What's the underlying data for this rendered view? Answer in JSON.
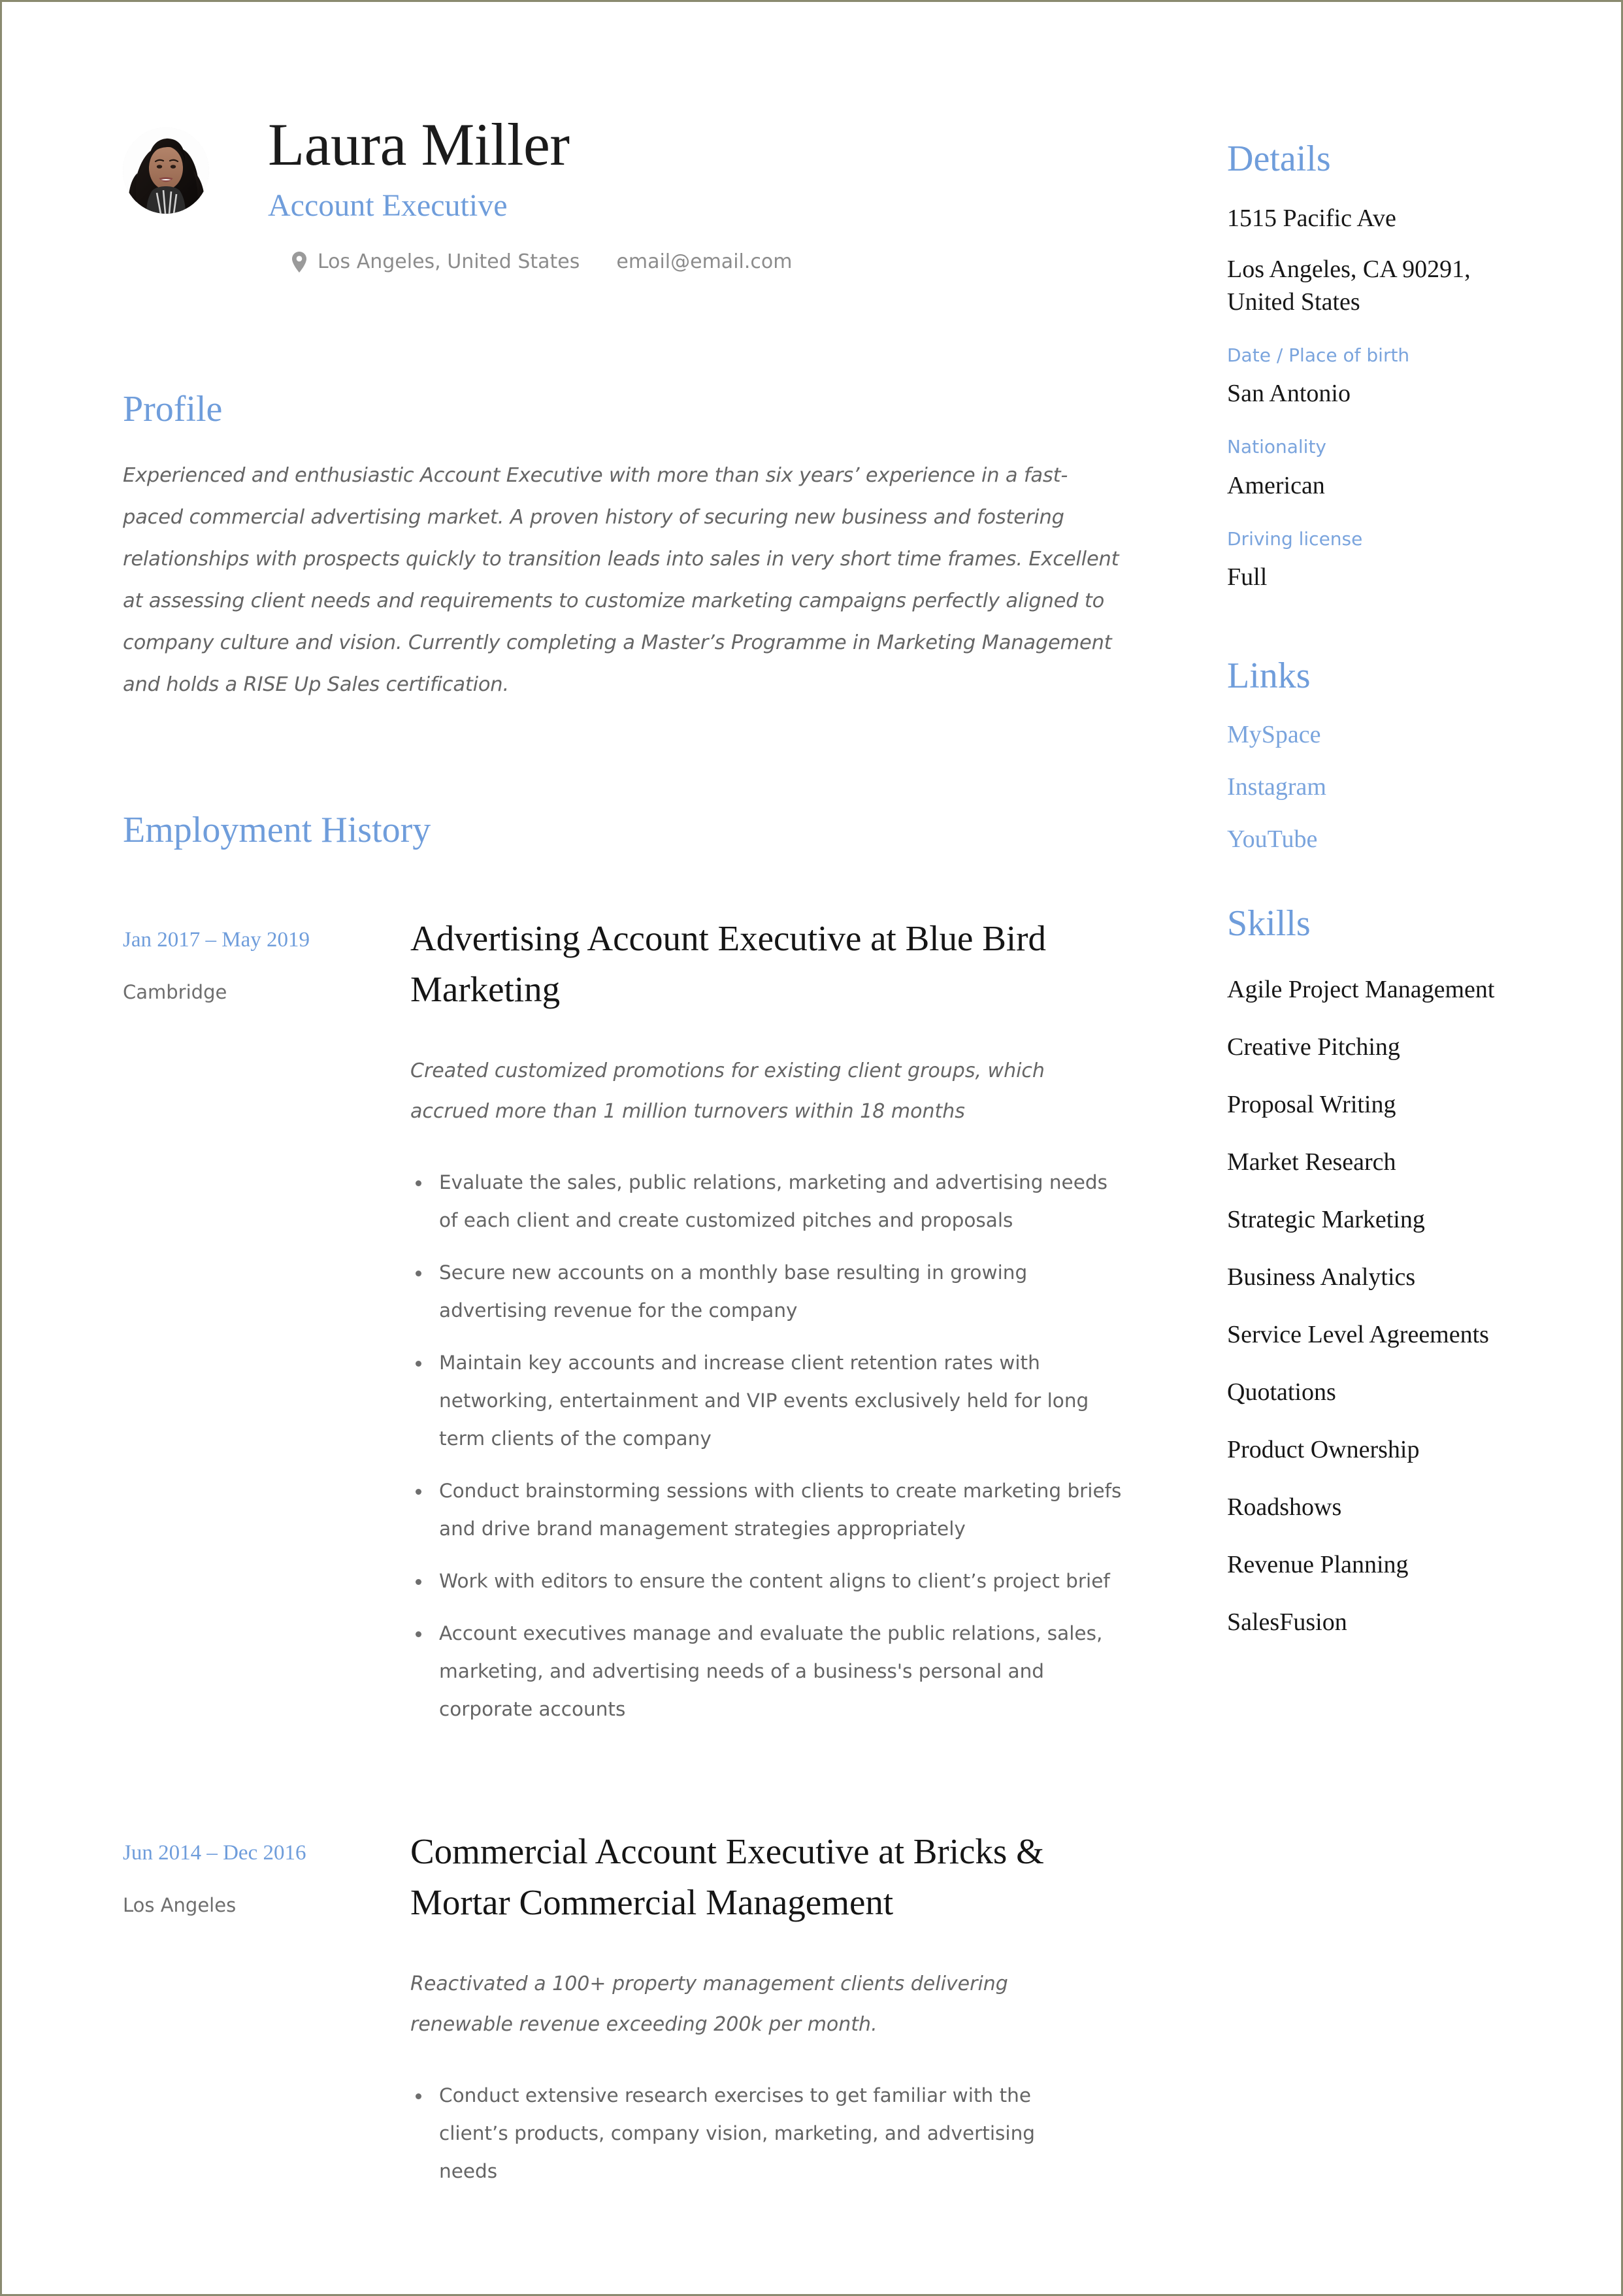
{
  "accent_color": "#6f9ddb",
  "text_color": "#171717",
  "muted_color": "#666666",
  "header": {
    "name": "Laura Miller",
    "job_title": "Account Executive",
    "location": "Los Angeles, United States",
    "email": "email@email.com"
  },
  "profile": {
    "title": "Profile",
    "text": "Experienced and enthusiastic Account Executive with more than six years’ experience in a fast-paced commercial advertising market. A proven history of securing new business and fostering relationships with prospects quickly to transition leads into sales in very short time frames. Excellent at assessing client needs and requirements to customize marketing campaigns perfectly aligned to company culture and vision. Currently completing a Master’s Programme in Marketing Management and holds a RISE Up Sales certification."
  },
  "employment": {
    "title": "Employment History",
    "jobs": [
      {
        "dates": "Jan 2017 – May 2019",
        "location": "Cambridge",
        "heading": "Advertising Account Executive at Blue Bird Marketing",
        "summary": "Created customized promotions for existing client groups, which accrued more than 1 million turnovers within 18 months",
        "bullets": [
          "Evaluate the sales, public relations, marketing and advertising needs of each client and create customized pitches and proposals",
          "Secure new accounts on a monthly base resulting in growing advertising revenue for the company",
          "Maintain key accounts and increase client retention rates with networking, entertainment and VIP events exclusively held for long term clients of the company",
          "Conduct brainstorming sessions with clients to create marketing briefs and drive brand management strategies appropriately",
          "Work with editors to ensure the content aligns to client’s project brief",
          "Account executives manage and evaluate the public relations, sales, marketing, and advertising needs of a business's personal and corporate accounts"
        ]
      },
      {
        "dates": "Jun 2014 – Dec 2016",
        "location": "Los Angeles",
        "heading": "Commercial Account Executive at Bricks & Mortar Commercial Management",
        "summary": "Reactivated a 100+ property management clients delivering renewable revenue exceeding 200k per month.",
        "bullets": [
          "Conduct extensive research exercises to get familiar with the client’s products, company vision, marketing, and advertising needs"
        ]
      }
    ]
  },
  "details": {
    "title": "Details",
    "address_line1": "1515 Pacific Ave",
    "address_line2": "Los Angeles, CA 90291, United States",
    "birth_label": "Date / Place of birth",
    "birth_value": "San Antonio",
    "nationality_label": "Nationality",
    "nationality_value": "American",
    "license_label": "Driving license",
    "license_value": "Full"
  },
  "links": {
    "title": "Links",
    "items": [
      {
        "label": "MySpace"
      },
      {
        "label": "Instagram"
      },
      {
        "label": "YouTube"
      }
    ]
  },
  "skills": {
    "title": "Skills",
    "items": [
      "Agile Project Management",
      "Creative Pitching",
      "Proposal Writing",
      "Market Research",
      "Strategic Marketing",
      "Business Analytics",
      "Service Level Agreements",
      "Quotations",
      "Product Ownership",
      "Roadshows",
      "Revenue Planning",
      "SalesFusion"
    ]
  }
}
